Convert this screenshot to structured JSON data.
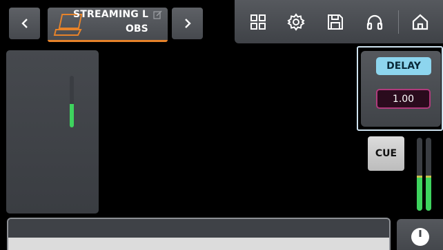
{
  "header": {
    "channel_name": "STREAMING L",
    "channel_sub": "OBS",
    "accent_color": "#e7832a"
  },
  "toolbar": {
    "icons": [
      "grid-icon",
      "settings-icon",
      "save-icon",
      "headphones-icon",
      "home-icon"
    ]
  },
  "delay": {
    "label": "DELAY",
    "value": "1.00",
    "label_color": "#8dd5ee",
    "value_border_color": "#b13a7c"
  },
  "cue": {
    "label": "CUE"
  },
  "meters": {
    "channel_level": 0.45,
    "master_left_level": 0.45,
    "master_right_level": 0.45,
    "meter_color": "#3ed35e"
  }
}
